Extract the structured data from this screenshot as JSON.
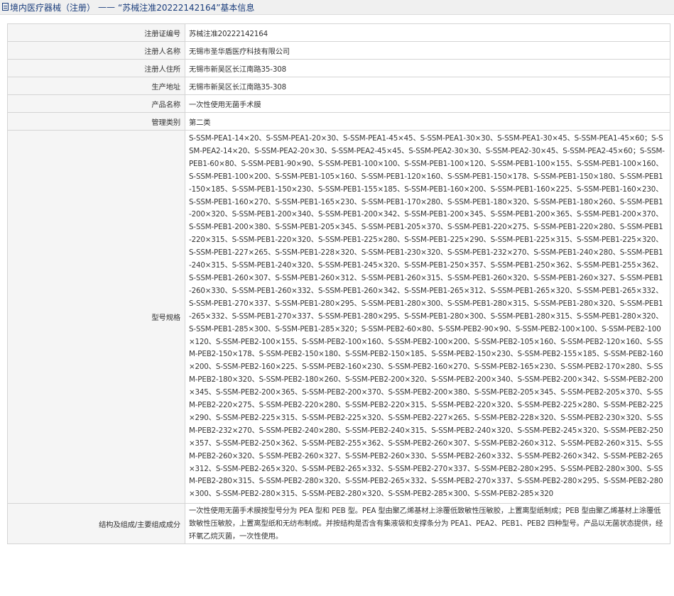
{
  "header": {
    "breadcrumb": "境内医疗器械（注册）",
    "separator": "——",
    "record_title": "“苏械注准20222142164”基本信息"
  },
  "fields": [
    {
      "label": "注册证编号",
      "value": "苏械注准20222142164"
    },
    {
      "label": "注册人名称",
      "value": "无锡市圣华盾医疗科技有限公司"
    },
    {
      "label": "注册人住所",
      "value": "无锡市新吴区长江南路35-308"
    },
    {
      "label": "生产地址",
      "value": "无锡市新吴区长江南路35-308"
    },
    {
      "label": "产品名称",
      "value": "一次性使用无菌手术膜"
    },
    {
      "label": "管理类别",
      "value": "第二类"
    },
    {
      "label": "型号规格",
      "value": "S-SSM-PEA1-14×20、S-SSM-PEA1-20×30、S-SSM-PEA1-45×45、S-SSM-PEA1-30×30、S-SSM-PEA1-30×45、S-SSM-PEA1-45×60；S-SSM-PEA2-14×20、S-SSM-PEA2-20×30、S-SSM-PEA2-45×45、S-SSM-PEA2-30×30、S-SSM-PEA2-30×45、S-SSM-PEA2-45×60；S-SSM-PEB1-60×80、S-SSM-PEB1-90×90、S-SSM-PEB1-100×100、S-SSM-PEB1-100×120、S-SSM-PEB1-100×155、S-SSM-PEB1-100×160、S-SSM-PEB1-100×200、S-SSM-PEB1-105×160、S-SSM-PEB1-120×160、S-SSM-PEB1-150×178、S-SSM-PEB1-150×180、S-SSM-PEB1-150×185、S-SSM-PEB1-150×230、S-SSM-PEB1-155×185、S-SSM-PEB1-160×200、S-SSM-PEB1-160×225、S-SSM-PEB1-160×230、S-SSM-PEB1-160×270、S-SSM-PEB1-165×230、S-SSM-PEB1-170×280、S-SSM-PEB1-180×320、S-SSM-PEB1-180×260、S-SSM-PEB1-200×320、S-SSM-PEB1-200×340、S-SSM-PEB1-200×342、S-SSM-PEB1-200×345、S-SSM-PEB1-200×365、S-SSM-PEB1-200×370、S-SSM-PEB1-200×380、S-SSM-PEB1-205×345、S-SSM-PEB1-205×370、S-SSM-PEB1-220×275、S-SSM-PEB1-220×280、S-SSM-PEB1-220×315、S-SSM-PEB1-220×320、S-SSM-PEB1-225×280、S-SSM-PEB1-225×290、S-SSM-PEB1-225×315、S-SSM-PEB1-225×320、S-SSM-PEB1-227×265、S-SSM-PEB1-228×320、S-SSM-PEB1-230×320、S-SSM-PEB1-232×270、S-SSM-PEB1-240×280、S-SSM-PEB1-240×315、S-SSM-PEB1-240×320、S-SSM-PEB1-245×320、S-SSM-PEB1-250×357、S-SSM-PEB1-250×362、S-SSM-PEB1-255×362、S-SSM-PEB1-260×307、S-SSM-PEB1-260×312、S-SSM-PEB1-260×315、S-SSM-PEB1-260×320、S-SSM-PEB1-260×327、S-SSM-PEB1-260×330、S-SSM-PEB1-260×332、S-SSM-PEB1-260×342、S-SSM-PEB1-265×312、S-SSM-PEB1-265×320、S-SSM-PEB1-265×332、S-SSM-PEB1-270×337、S-SSM-PEB1-280×295、S-SSM-PEB1-280×300、S-SSM-PEB1-280×315、S-SSM-PEB1-280×320、S-SSM-PEB1-265×332、S-SSM-PEB1-270×337、S-SSM-PEB1-280×295、S-SSM-PEB1-280×300、S-SSM-PEB1-280×315、S-SSM-PEB1-280×320、S-SSM-PEB1-285×300、S-SSM-PEB1-285×320；S-SSM-PEB2-60×80、S-SSM-PEB2-90×90、S-SSM-PEB2-100×100、S-SSM-PEB2-100×120、S-SSM-PEB2-100×155、S-SSM-PEB2-100×160、S-SSM-PEB2-100×200、S-SSM-PEB2-105×160、S-SSM-PEB2-120×160、S-SSM-PEB2-150×178、S-SSM-PEB2-150×180、S-SSM-PEB2-150×185、S-SSM-PEB2-150×230、S-SSM-PEB2-155×185、S-SSM-PEB2-160×200、S-SSM-PEB2-160×225、S-SSM-PEB2-160×230、S-SSM-PEB2-160×270、S-SSM-PEB2-165×230、S-SSM-PEB2-170×280、S-SSM-PEB2-180×320、S-SSM-PEB2-180×260、S-SSM-PEB2-200×320、S-SSM-PEB2-200×340、S-SSM-PEB2-200×342、S-SSM-PEB2-200×345、S-SSM-PEB2-200×365、S-SSM-PEB2-200×370、S-SSM-PEB2-200×380、S-SSM-PEB2-205×345、S-SSM-PEB2-205×370、S-SSM-PEB2-220×275、S-SSM-PEB2-220×280、S-SSM-PEB2-220×315、S-SSM-PEB2-220×320、S-SSM-PEB2-225×280、S-SSM-PEB2-225×290、S-SSM-PEB2-225×315、S-SSM-PEB2-225×320、S-SSM-PEB2-227×265、S-SSM-PEB2-228×320、S-SSM-PEB2-230×320、S-SSM-PEB2-232×270、S-SSM-PEB2-240×280、S-SSM-PEB2-240×315、S-SSM-PEB2-240×320、S-SSM-PEB2-245×320、S-SSM-PEB2-250×357、S-SSM-PEB2-250×362、S-SSM-PEB2-255×362、S-SSM-PEB2-260×307、S-SSM-PEB2-260×312、S-SSM-PEB2-260×315、S-SSM-PEB2-260×320、S-SSM-PEB2-260×327、S-SSM-PEB2-260×330、S-SSM-PEB2-260×332、S-SSM-PEB2-260×342、S-SSM-PEB2-265×312、S-SSM-PEB2-265×320、S-SSM-PEB2-265×332、S-SSM-PEB2-270×337、S-SSM-PEB2-280×295、S-SSM-PEB2-280×300、S-SSM-PEB2-280×315、S-SSM-PEB2-280×320、S-SSM-PEB2-265×332、S-SSM-PEB2-270×337、S-SSM-PEB2-280×295、S-SSM-PEB2-280×300、S-SSM-PEB2-280×315、S-SSM-PEB2-280×320、S-SSM-PEB2-285×300、S-SSM-PEB2-285×320"
    },
    {
      "label": "结构及组成/主要组成成分",
      "value": "一次性使用无菌手术膜按型号分为 PEA 型和 PEB 型。PEA 型由聚乙烯基材上涂覆低致敏性压敏胶，上置离型纸制成；PEB 型由聚乙烯基材上涂覆低致敏性压敏胶，上置离型纸和无纺布制成。并按结构是否含有集液袋和支撑条分为 PEA1、PEA2、PEB1、PEB2 四种型号。产品以无菌状态提供，经环氧乙烷灭菌，一次性使用。"
    }
  ]
}
